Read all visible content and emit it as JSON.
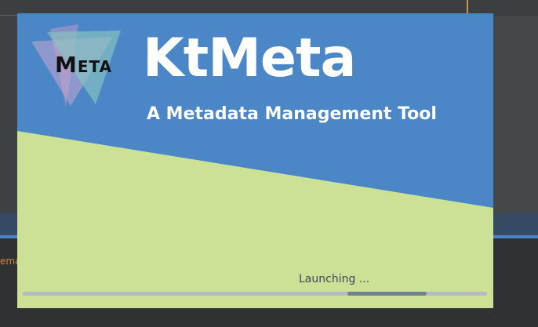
{
  "background": {
    "partial_text": "ema"
  },
  "splash": {
    "logo_text": "Meta",
    "title": "KtMeta",
    "subtitle": "A Metadata Management Tool",
    "status": "Launching ...",
    "colors": {
      "blue": "#4b86c6",
      "green": "#cce096",
      "title": "#ffffff"
    },
    "progress": {
      "indeterminate": true,
      "segment_start": 0.7,
      "segment_end": 0.87
    }
  }
}
